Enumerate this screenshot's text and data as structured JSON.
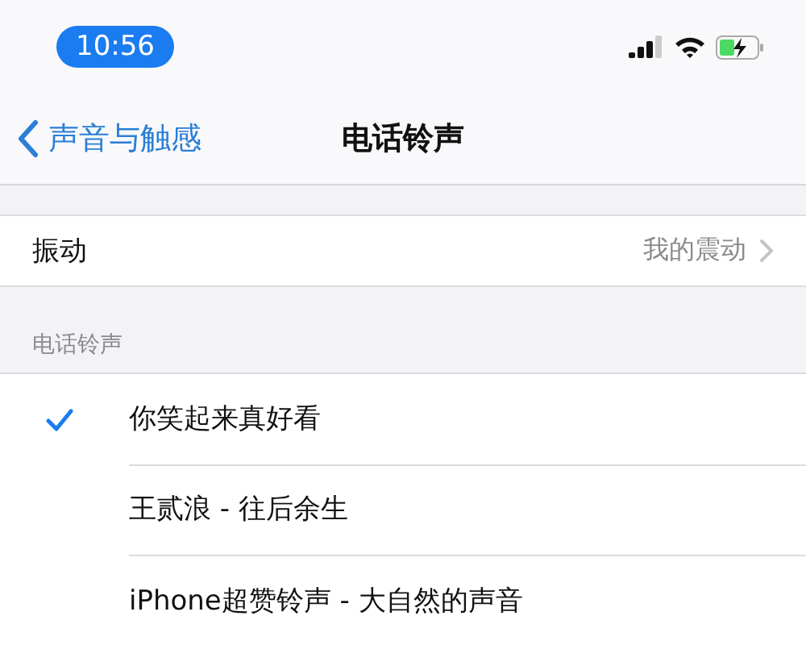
{
  "status_bar": {
    "time": "10:56",
    "charging": true
  },
  "nav": {
    "back_label": "声音与触感",
    "title": "电话铃声"
  },
  "vibration": {
    "label": "振动",
    "value": "我的震动"
  },
  "ringtones": {
    "header": "电话铃声",
    "items": [
      {
        "label": "你笑起来真好看",
        "selected": true
      },
      {
        "label": "王贰浪 - 往后余生",
        "selected": false
      },
      {
        "label": "iPhone超赞铃声 - 大自然的声音",
        "selected": false
      }
    ]
  }
}
